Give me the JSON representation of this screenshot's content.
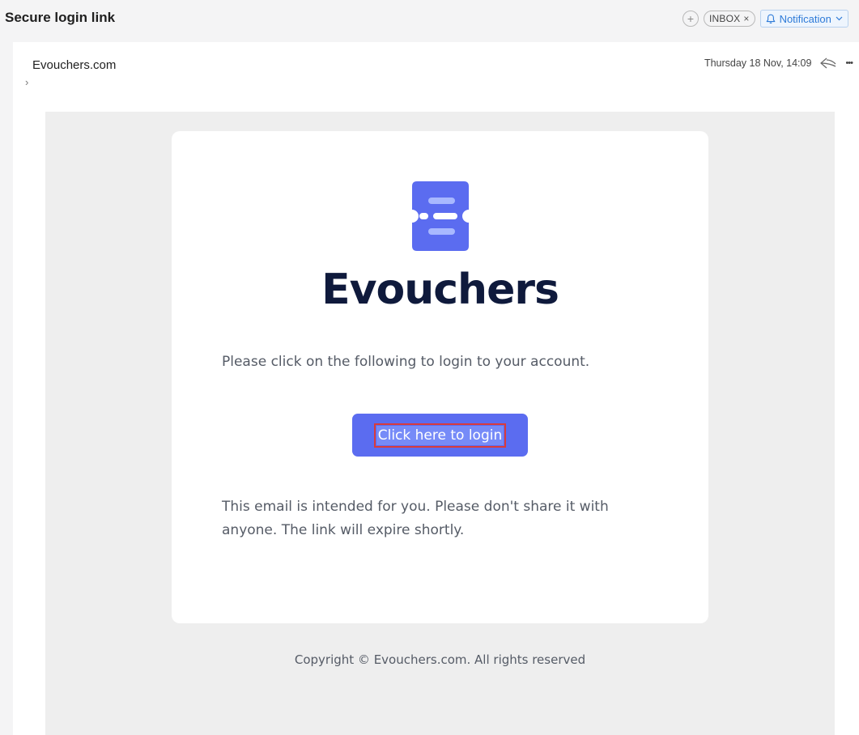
{
  "header": {
    "subject": "Secure login link",
    "plus_icon": "+",
    "tag_label": "INBOX",
    "tag_remove": "×",
    "notification_label": "Notification"
  },
  "message": {
    "sender": "Evouchers.com",
    "expand_icon": "›",
    "date": "Thursday 18 Nov, 14:09",
    "more_icon": "•••"
  },
  "email": {
    "brand": "Evouchers",
    "intro": "Please click on the following to login to your account.",
    "button_label": "Click here to login",
    "notice_line1": "This email is intended for you. Please don't share it with",
    "notice_line2": "anyone. The link will expire shortly.",
    "copyright": "Copyright © Evouchers.com. All rights reserved"
  },
  "colors": {
    "brand_blue": "#5b6cf0",
    "brand_dark": "#0f1a3c",
    "notification_blue": "#2d7ad8",
    "highlight_red": "#d93b3b"
  },
  "icons": [
    "plus-icon",
    "close-icon",
    "bell-icon",
    "chevron-down-icon",
    "chevron-right-icon",
    "reply-icon",
    "more-icon",
    "evouchers-logo-icon"
  ]
}
